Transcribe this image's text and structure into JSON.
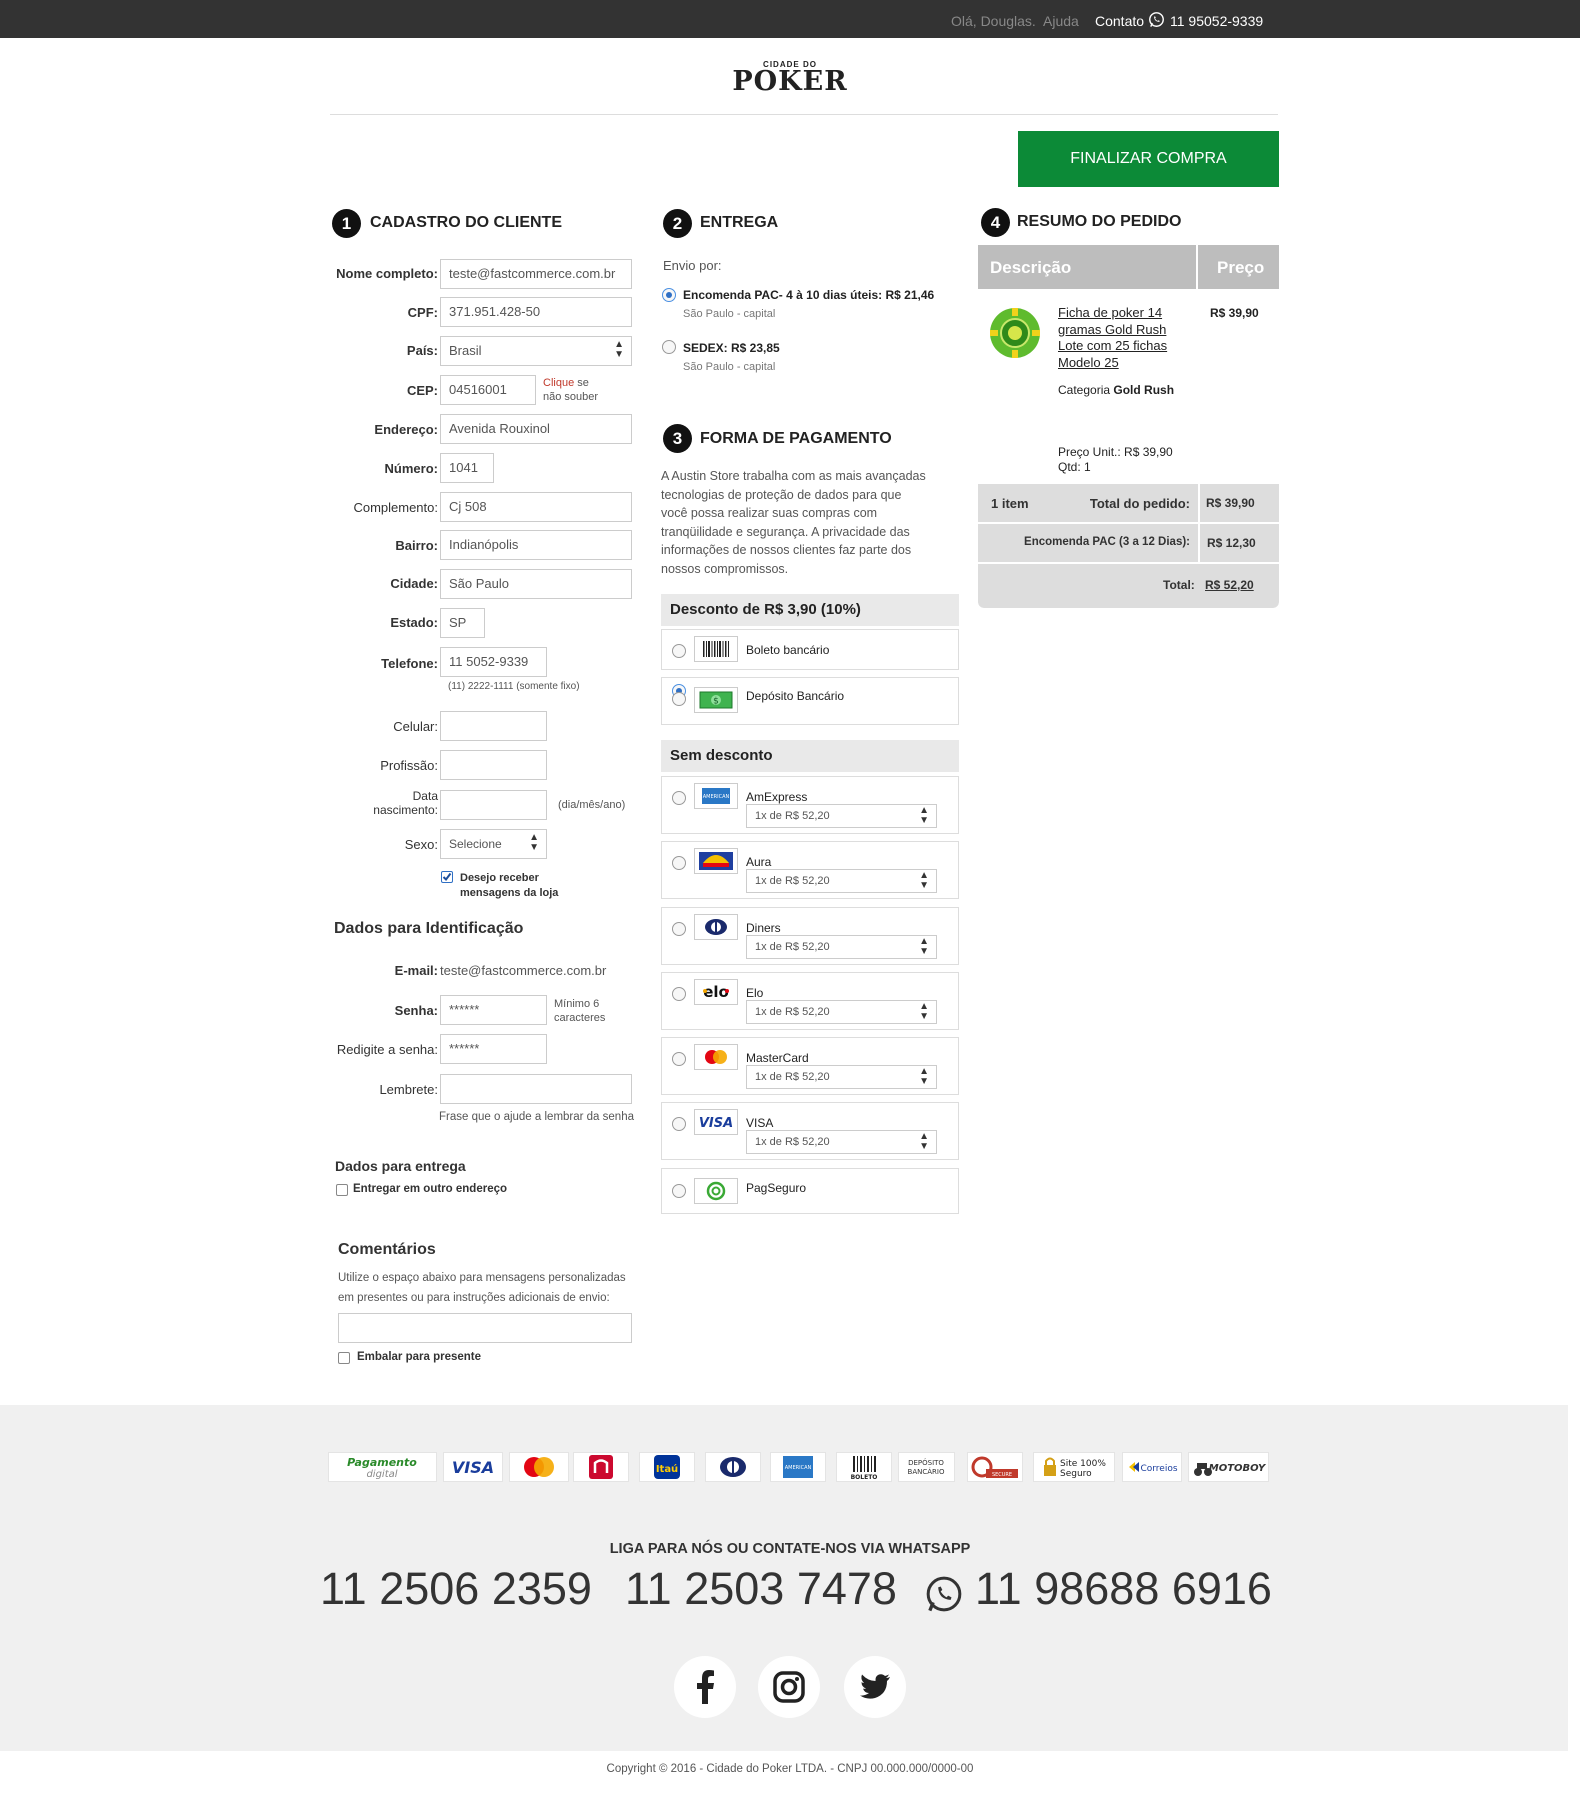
{
  "topbar": {
    "greeting": "Olá, Douglas.",
    "help": "Ajuda",
    "contact": "Contato",
    "phone": "11 95052-9339"
  },
  "logo": {
    "small": "CIDADE DO",
    "big": "POKER"
  },
  "finalize_label": "FINALIZAR COMPRA",
  "section1": {
    "number": "1",
    "title": "CADASTRO DO CLIENTE",
    "fields": {
      "nome": {
        "label": "Nome completo:",
        "value": "teste@fastcommerce.com.br"
      },
      "cpf": {
        "label": "CPF:",
        "value": "371.951.428-50"
      },
      "pais": {
        "label": "País:",
        "value": "Brasil"
      },
      "cep": {
        "label": "CEP:",
        "value": "04516001",
        "help_link": "Clique",
        "help_text1": " se",
        "help_text2": "não souber"
      },
      "endereco": {
        "label": "Endereço:",
        "value": "Avenida Rouxinol"
      },
      "numero": {
        "label": "Número:",
        "value": "1041"
      },
      "complemento": {
        "label": "Complemento:",
        "value": "Cj 508"
      },
      "bairro": {
        "label": "Bairro:",
        "value": "Indianópolis"
      },
      "cidade": {
        "label": "Cidade:",
        "value": "São Paulo"
      },
      "estado": {
        "label": "Estado:",
        "value": "SP"
      },
      "telefone": {
        "label": "Telefone:",
        "value": "11 5052-9339",
        "hint": "(11) 2222-1111 (somente fixo)"
      },
      "celular": {
        "label": "Celular:",
        "value": ""
      },
      "profissao": {
        "label": "Profissão:",
        "value": ""
      },
      "nascimento": {
        "label1": "Data",
        "label2": "nascimento:",
        "value": "",
        "hint": "(dia/mês/ano)"
      },
      "sexo": {
        "label": "Sexo:",
        "value": "Selecione"
      },
      "newsletter": {
        "line1": "Desejo receber",
        "line2": "mensagens da loja",
        "checked": true
      }
    },
    "ident": {
      "title": "Dados para Identificação",
      "email_label": "E-mail:",
      "email_value": "teste@fastcommerce.com.br",
      "senha_label": "Senha:",
      "senha_value": "******",
      "senha_hint1": "Mínimo 6",
      "senha_hint2": "caracteres",
      "redigite_label": "Redigite a senha:",
      "redigite_value": "******",
      "lembrete_label": "Lembrete:",
      "lembrete_value": "",
      "lembrete_hint": "Frase que o ajude a lembrar da senha"
    },
    "entrega": {
      "title": "Dados para entrega",
      "checkbox": "Entregar em outro endereço"
    },
    "comentarios": {
      "title": "Comentários",
      "desc1": "Utilize o espaço abaixo para mensagens personalizadas",
      "desc2": "em presentes ou para instruções adicionais de envio:",
      "value": "",
      "gift": "Embalar para presente"
    }
  },
  "section2": {
    "number": "2",
    "title": "ENTREGA",
    "envio_label": "Envio por:",
    "options": [
      {
        "name": "Encomenda PAC- 4 à 10 dias úteis: R$ 21,46",
        "sub": "São Paulo - capital",
        "selected": true
      },
      {
        "name": "SEDEX: R$ 23,85",
        "sub": "São Paulo - capital",
        "selected": false
      }
    ]
  },
  "section3": {
    "number": "3",
    "title": "FORMA DE PAGAMENTO",
    "text": [
      "A Austin Store trabalha com as mais avançadas",
      "tecnologias de proteção de dados para que",
      "você possa realizar suas compras com",
      "tranqüilidade e segurança. A privacidade das",
      "informações de nossos clientes faz parte dos",
      "nossos compromissos."
    ],
    "discount_title": "Desconto de R$ 3,90 (10%)",
    "discount_methods": [
      {
        "name": "Boleto bancário",
        "icon": "barcode-icon"
      },
      {
        "name": "Depósito Bancário",
        "icon": "cash-icon",
        "selected": true
      }
    ],
    "nodiscount_title": "Sem desconto",
    "cards": [
      {
        "name": "AmExpress",
        "installments": "1x de R$ 52,20",
        "icon": "amex-icon"
      },
      {
        "name": "Aura",
        "installments": "1x de R$ 52,20",
        "icon": "aura-icon"
      },
      {
        "name": "Diners",
        "installments": "1x de R$ 52,20",
        "icon": "diners-icon"
      },
      {
        "name": "Elo",
        "installments": "1x de R$ 52,20",
        "icon": "elo-icon"
      },
      {
        "name": "MasterCard",
        "installments": "1x de R$ 52,20",
        "icon": "mastercard-icon"
      },
      {
        "name": "VISA",
        "installments": "1x de R$ 52,20",
        "icon": "visa-icon"
      },
      {
        "name": "PagSeguro",
        "icon": "pagseguro-icon"
      }
    ]
  },
  "section4": {
    "number": "4",
    "title": "RESUMO DO PEDIDO",
    "table_header": {
      "desc": "Descrição",
      "price": "Preço"
    },
    "product": {
      "name_lines": [
        "Ficha de poker 14",
        "gramas Gold Rush",
        "Lote com 25 fichas",
        "Modelo 25"
      ],
      "price": "R$ 39,90",
      "category_label": "Categoria",
      "category_value": "Gold Rush",
      "unit_price": "Preço Unit.: R$ 39,90",
      "qty": "Qtd: 1"
    },
    "totals": {
      "items": "1 item",
      "total_label": "Total do pedido:",
      "total_value": "R$ 39,90",
      "shipping_label": "Encomenda PAC (3 a 12 Dias):",
      "shipping_value": "R$ 12,30",
      "grand_label": "Total:",
      "grand_value": "R$ 52,20"
    }
  },
  "footer": {
    "badges": [
      "Pagamento digital",
      "VISA",
      "MasterCard",
      "Bradesco",
      "Itaú",
      "Diners",
      "American Express",
      "BOLETO",
      "DEPÓSITO BANCÁRIO",
      "Comodo Secure",
      "Site 100% Seguro",
      "Correios",
      "MOTOBOY"
    ],
    "contact_title": "LIGA PARA NÓS OU CONTATE-NOS VIA WHATSAPP",
    "phones": [
      "11 2506 2359",
      "11 2503 7478",
      "11 98688 6916"
    ],
    "social": [
      "facebook-icon",
      "instagram-icon",
      "twitter-icon"
    ],
    "copyright": "Copyright © 2016 - Cidade do Poker LTDA. - CNPJ 00.000.000/0000-00"
  },
  "colors": {
    "green": "#0c8a37",
    "topbar": "#333333",
    "footer_bg": "#f0f0f0",
    "table_header": "#bdbdbd"
  }
}
